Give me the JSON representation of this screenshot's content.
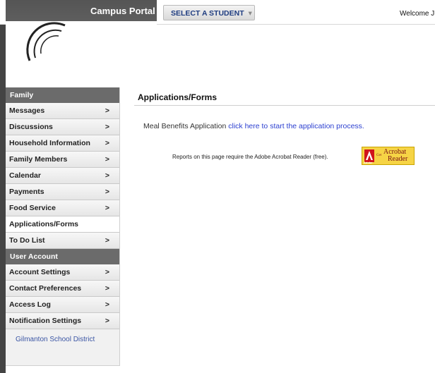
{
  "header": {
    "app_title": "Campus Portal",
    "select_student_label": "SELECT A STUDENT",
    "welcome_text": "Welcome J"
  },
  "sidebar": {
    "sections": [
      {
        "title": "Family",
        "items": [
          {
            "label": "Messages",
            "chevron": true,
            "active": false
          },
          {
            "label": "Discussions",
            "chevron": true,
            "active": false
          },
          {
            "label": "Household Information",
            "chevron": true,
            "active": false
          },
          {
            "label": "Family Members",
            "chevron": true,
            "active": false
          },
          {
            "label": "Calendar",
            "chevron": true,
            "active": false
          },
          {
            "label": "Payments",
            "chevron": true,
            "active": false
          },
          {
            "label": "Food Service",
            "chevron": true,
            "active": false
          },
          {
            "label": "Applications/Forms",
            "chevron": false,
            "active": true
          },
          {
            "label": "To Do List",
            "chevron": true,
            "active": false
          }
        ]
      },
      {
        "title": "User Account",
        "items": [
          {
            "label": "Account Settings",
            "chevron": true,
            "active": false
          },
          {
            "label": "Contact Preferences",
            "chevron": true,
            "active": false
          },
          {
            "label": "Access Log",
            "chevron": true,
            "active": false
          },
          {
            "label": "Notification Settings",
            "chevron": true,
            "active": false
          }
        ]
      }
    ],
    "district_link": "Gilmanton School District"
  },
  "main": {
    "title": "Applications/Forms",
    "meal_label": "Meal Benefits Application",
    "meal_link": "click here to start the application process.",
    "reader_note": "Reports on this page require the Adobe Acrobat Reader (free).",
    "acrobat_badge": {
      "get": "Get",
      "word1": "Acrobat",
      "word2": "Reader",
      "adobe": "Adobe"
    }
  },
  "colors": {
    "nav_header": "#6b6b6b",
    "link": "#2b3fd0",
    "district_link": "#3a55a4",
    "acrobat_badge": "#f6d445"
  },
  "icons": {
    "nav_chevron": "chevron-right-icon",
    "select_caret": "chevron-down-icon",
    "acrobat_logo": "adobe-logo-icon",
    "portal_logo": "campus-arcs-logo"
  }
}
